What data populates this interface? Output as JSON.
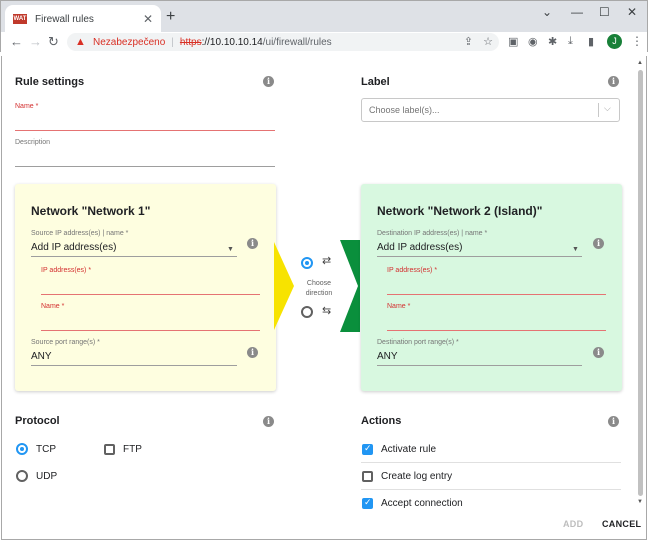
{
  "browser": {
    "tab_title": "Firewall rules",
    "favicon_text": "WAT",
    "new_tab": "+",
    "insecure_label": "Nezabezpečeno",
    "url_scheme": "https",
    "url_host": "://10.10.10.14",
    "url_path": "/ui/firewall/rules",
    "profile_initial": "J"
  },
  "rule_settings": {
    "title": "Rule settings",
    "name_label": "Name *",
    "name_value": "",
    "description_label": "Description",
    "description_value": ""
  },
  "label_section": {
    "title": "Label",
    "placeholder": "Choose label(s)..."
  },
  "source": {
    "title": "Network \"Network 1\"",
    "ip_label": "Source IP address(es) | name *",
    "ip_value": "Add IP address(es)",
    "sub_ip_label": "IP address(es) *",
    "sub_name_label": "Name *",
    "port_label": "Source port range(s) *",
    "port_value": "ANY"
  },
  "destination": {
    "title": "Network \"Network 2 (Island)\"",
    "ip_label": "Destination IP address(es) | name *",
    "ip_value": "Add IP address(es)",
    "sub_ip_label": "IP address(es) *",
    "sub_name_label": "Name *",
    "port_label": "Destination port range(s) *",
    "port_value": "ANY"
  },
  "direction": {
    "label": "Choose direction",
    "selected": "forward"
  },
  "protocol": {
    "title": "Protocol",
    "options": [
      {
        "label": "TCP",
        "checked": true
      },
      {
        "label": "FTP",
        "checked": false
      },
      {
        "label": "UDP",
        "checked": false
      }
    ]
  },
  "actions": {
    "title": "Actions",
    "options": [
      {
        "label": "Activate rule",
        "checked": true
      },
      {
        "label": "Create log entry",
        "checked": false
      },
      {
        "label": "Accept connection",
        "checked": true
      }
    ]
  },
  "buttons": {
    "add": "ADD",
    "cancel": "CANCEL"
  },
  "colors": {
    "source_panel": "#fefee0",
    "destination_panel": "#d8f8e0",
    "arrow_yellow": "#f7e300",
    "arrow_green": "#0a8f3c",
    "accent": "#2196f3",
    "error": "#d32f2f"
  }
}
